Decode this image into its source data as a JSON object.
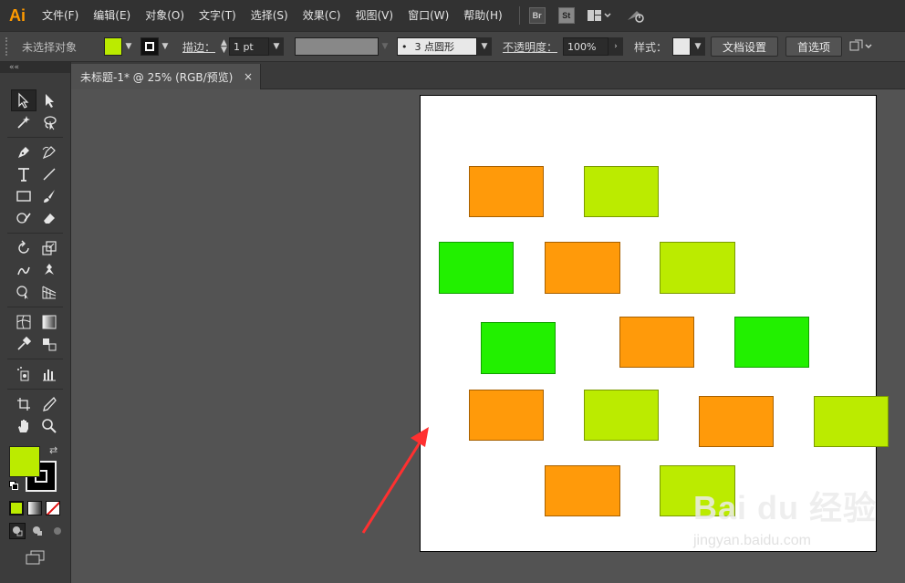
{
  "app": {
    "logo": "Ai"
  },
  "menu": [
    "文件(F)",
    "编辑(E)",
    "对象(O)",
    "文字(T)",
    "选择(S)",
    "效果(C)",
    "视图(V)",
    "窗口(W)",
    "帮助(H)"
  ],
  "menu_badges": [
    "Br",
    "St"
  ],
  "control_bar": {
    "selection_status": "未选择对象",
    "fill_color": "#bbeb00",
    "stroke_label": "描边：",
    "stroke_weight": "1 pt",
    "brush_profile": "3 点圆形",
    "opacity_label": "不透明度：",
    "opacity_value": "100%",
    "style_label": "样式：",
    "doc_setup_button": "文档设置",
    "preferences_button": "首选项"
  },
  "document_tab": {
    "title": "未标题-1* @ 25% (RGB/预览)",
    "close": "×"
  },
  "toolbox": {
    "collapse": "««",
    "fill_color": "#bbeb00",
    "stroke_color": "#000000"
  },
  "artboard": {
    "shapes": [
      {
        "color": "orange"
      },
      {
        "color": "lime"
      },
      {
        "color": "green"
      },
      {
        "color": "orange"
      },
      {
        "color": "lime"
      },
      {
        "color": "green"
      },
      {
        "color": "orange"
      },
      {
        "color": "green"
      },
      {
        "color": "orange"
      },
      {
        "color": "lime"
      },
      {
        "color": "orange"
      },
      {
        "color": "lime"
      },
      {
        "color": "orange"
      },
      {
        "color": "lime"
      }
    ]
  },
  "colors": {
    "orange": "#ff9a0a",
    "lime": "#bbeb00",
    "green": "#22f000",
    "arrow": "#ff3030"
  },
  "watermark": {
    "main": "Bai du 经验",
    "sub": "jingyan.baidu.com"
  }
}
